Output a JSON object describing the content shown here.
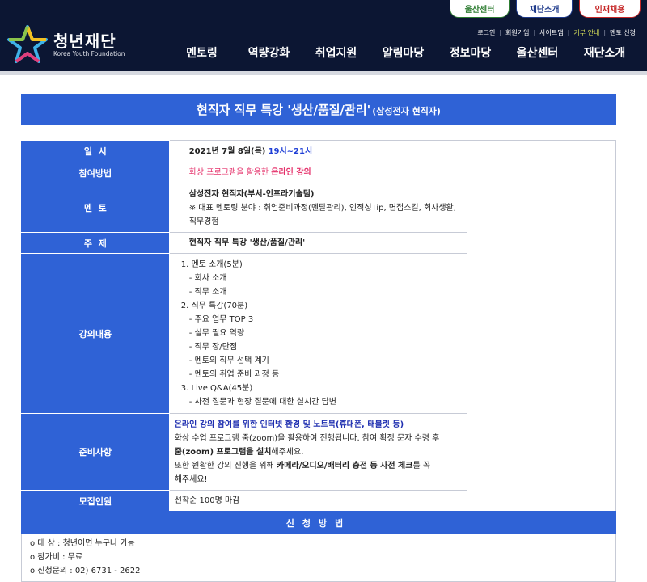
{
  "header": {
    "top_tabs": [
      {
        "label": "울산센터",
        "color": "#2e7d32"
      },
      {
        "label": "재단소개",
        "color": "#1f3b8c"
      },
      {
        "label": "인재채용",
        "color": "#c62828"
      }
    ],
    "util_links": [
      "로그인",
      "회원가입",
      "사이트맵",
      "기부 안내",
      "멘토 신청"
    ],
    "logo": {
      "ko": "청년재단",
      "en": "Korea Youth Foundation"
    },
    "gnb": [
      "멘토링",
      "역량강화",
      "취업지원",
      "알림마당",
      "정보마당",
      "울산센터",
      "재단소개"
    ]
  },
  "title": {
    "main": "현직자 직무 특강 '생산/품질/관리'",
    "sub": "(삼성전자 현직자)"
  },
  "rows": {
    "date": {
      "label": "일  시",
      "date_text": "2021년 7월 8일(목)",
      "time_text": "19시~21시"
    },
    "method": {
      "label": "참여방법",
      "text_prefix": "화상 프로그램을 활용한 ",
      "text_bold": "온라인 강의"
    },
    "mentor": {
      "label": "멘  토",
      "name": "삼성전자 현직자(부서-인프라기술팀)",
      "desc": "※ 대표 멘토링 분야 : 취업준비과정(멘탈관리), 인적성Tip, 면접스킬, 회사생활, 직무경험"
    },
    "topic": {
      "label": "주  제",
      "text": "현직자 직무 특강 '생산/품질/관리'"
    },
    "content": {
      "label": "강의내용",
      "lines": [
        "1. 멘토 소개(5분)",
        "  - 회사 소개",
        "  - 직무 소개",
        "2. 직무 특강(70분)",
        "  - 주요 업무 TOP 3",
        "  - 실무 필요 역량",
        "  - 직무 장/단점",
        "  - 멘토의 직무 선택 계기",
        "  - 멘토의 취업 준비 과정 등",
        "3. Live Q&A(45분)",
        "  - 사전 질문과 현장 질문에 대한 실시간 답변"
      ]
    },
    "prep": {
      "label": "준비사항",
      "headline": "온라인 강의 참여를 위한 인터넷 환경 및 노트북(휴대폰, 태블릿 등)",
      "line2": "화상 수업 프로그램 줌(zoom)을 활용하여 진행됩니다. 참여 확정 문자 수령 후",
      "line3_bold": "줌(zoom) 프로그램을 설치",
      "line3_rest": "해주세요.",
      "line4_prefix": "또한 원활한 강의 진행을 위해 ",
      "line4_bold": "카메라/오디오/배터리 충전 등 사전 체크",
      "line4_rest": "를 꼭",
      "line5": "해주세요!"
    },
    "recruit": {
      "label": "모집인원",
      "text": "선착순 100명 마감"
    }
  },
  "apply": {
    "title": "신청방법",
    "lines": [
      "o 대 상 : 청년이면 누구나 가능",
      "o 참가비 : 무료",
      "o 신청문의 : 02) 6731 - 2622"
    ]
  },
  "colors": {
    "primary": "#2f62d6",
    "header_bg": "#0c1633"
  }
}
